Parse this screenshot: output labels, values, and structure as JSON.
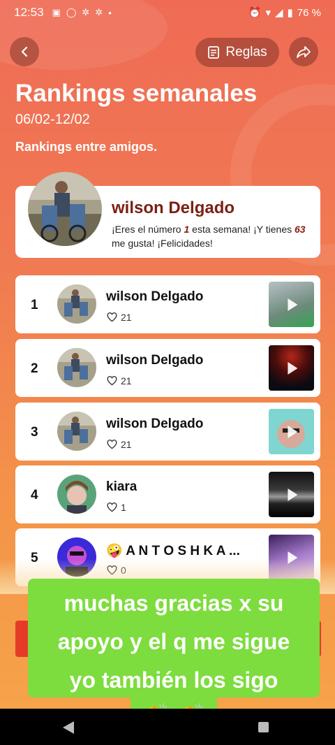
{
  "status_bar": {
    "time": "12:53",
    "battery": "76 %"
  },
  "header": {
    "rules_label": "Reglas",
    "title": "Rankings semanales",
    "date_range": "06/02-12/02",
    "subtitle": "Rankings entre amigos."
  },
  "winner": {
    "name": "wilson Delgado",
    "msg_pre": "¡Eres el número ",
    "rank": "1",
    "msg_mid": " esta semana! ¡Y tienes ",
    "likes": "63",
    "msg_post": " me gusta! ¡Felicidades!"
  },
  "rankings": [
    {
      "rank": "1",
      "name": "wilson Delgado",
      "likes": "21"
    },
    {
      "rank": "2",
      "name": "wilson Delgado",
      "likes": "21"
    },
    {
      "rank": "3",
      "name": "wilson Delgado",
      "likes": "21"
    },
    {
      "rank": "4",
      "name": "kiara",
      "likes": "1"
    },
    {
      "rank": "5",
      "name": "🤪 A N T O S H K A ...",
      "likes": "0"
    }
  ],
  "caption": {
    "line1": "muchas gracias x su",
    "line2": "apoyo y el q me sigue",
    "line3": "yo también los sigo",
    "emoji": "👏 👏"
  },
  "colors": {
    "accent": "#ef6b55",
    "caption_green": "#7ddc3e",
    "winner_name": "#7a1f14"
  }
}
